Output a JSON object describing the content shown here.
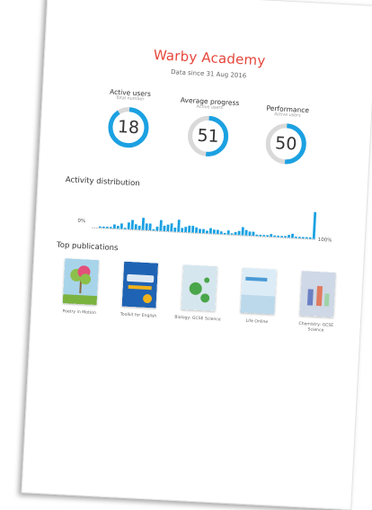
{
  "header": {
    "title": "Warby Academy",
    "subtitle": "Data since 31 Aug 2016"
  },
  "stats": [
    {
      "label": "Active users",
      "sublabel": "Total number",
      "value": "18",
      "fraction": 0.9
    },
    {
      "label": "Average progress",
      "sublabel": "Active users",
      "value": "51",
      "fraction": 0.51
    },
    {
      "label": "Performance",
      "sublabel": "Active users",
      "value": "50",
      "fraction": 0.5
    }
  ],
  "activity": {
    "title": "Activity distribution",
    "min_label": "0%",
    "max_label": "100%",
    "chart_data": {
      "type": "bar",
      "values": [
        0,
        0,
        1,
        1,
        1,
        1,
        3,
        2,
        4,
        1,
        5,
        7,
        4,
        3,
        9,
        5,
        5,
        1,
        3,
        8,
        4,
        5,
        6,
        3,
        9,
        3,
        4,
        5,
        5,
        4,
        3,
        3,
        2,
        4,
        3,
        3,
        2,
        1,
        3,
        1,
        2,
        3,
        6,
        4,
        3,
        3,
        1,
        1,
        1,
        1,
        2,
        1,
        1,
        1,
        1,
        2,
        3,
        1,
        1,
        1,
        1,
        1,
        20
      ],
      "ylim": [
        0,
        20
      ]
    }
  },
  "publications": {
    "title": "Top publications",
    "items": [
      {
        "caption": "Poetry in Motion",
        "color": "#a8d4ea",
        "accent": "#8cc04a"
      },
      {
        "caption": "Toolkit for English",
        "color": "#1f63b4",
        "accent": "#f2b21b"
      },
      {
        "caption": "Biology: GCSE Science",
        "color": "#d6e6ee",
        "accent": "#4aa64a"
      },
      {
        "caption": "Life Online",
        "color": "#dcecf6",
        "accent": "#4a9ad6"
      },
      {
        "caption": "Chemistry: GCSE Science",
        "color": "#cfd8e6",
        "accent": "#6b7fc4"
      }
    ]
  },
  "colors": {
    "accent": "#1ba1e2",
    "title": "#e5463b",
    "track": "#d9d9d9",
    "baseline": "#b0b0b0"
  }
}
